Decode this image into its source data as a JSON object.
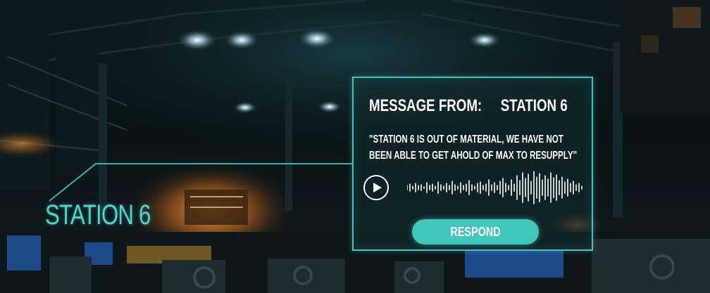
{
  "station_label": "STATION 6",
  "message": {
    "heading_prefix": "MESSAGE FROM:",
    "sender": "STATION 6",
    "body": "\"STATION 6 IS OUT OF MATERIAL, WE HAVE NOT BEEN ABLE TO GET AHOLD OF MAX TO RESUPPLY\""
  },
  "actions": {
    "respond_label": "RESPOND"
  },
  "icons": {
    "play": "play-icon"
  },
  "colors": {
    "accent": "#40c7b9",
    "text": "#ffffff"
  }
}
